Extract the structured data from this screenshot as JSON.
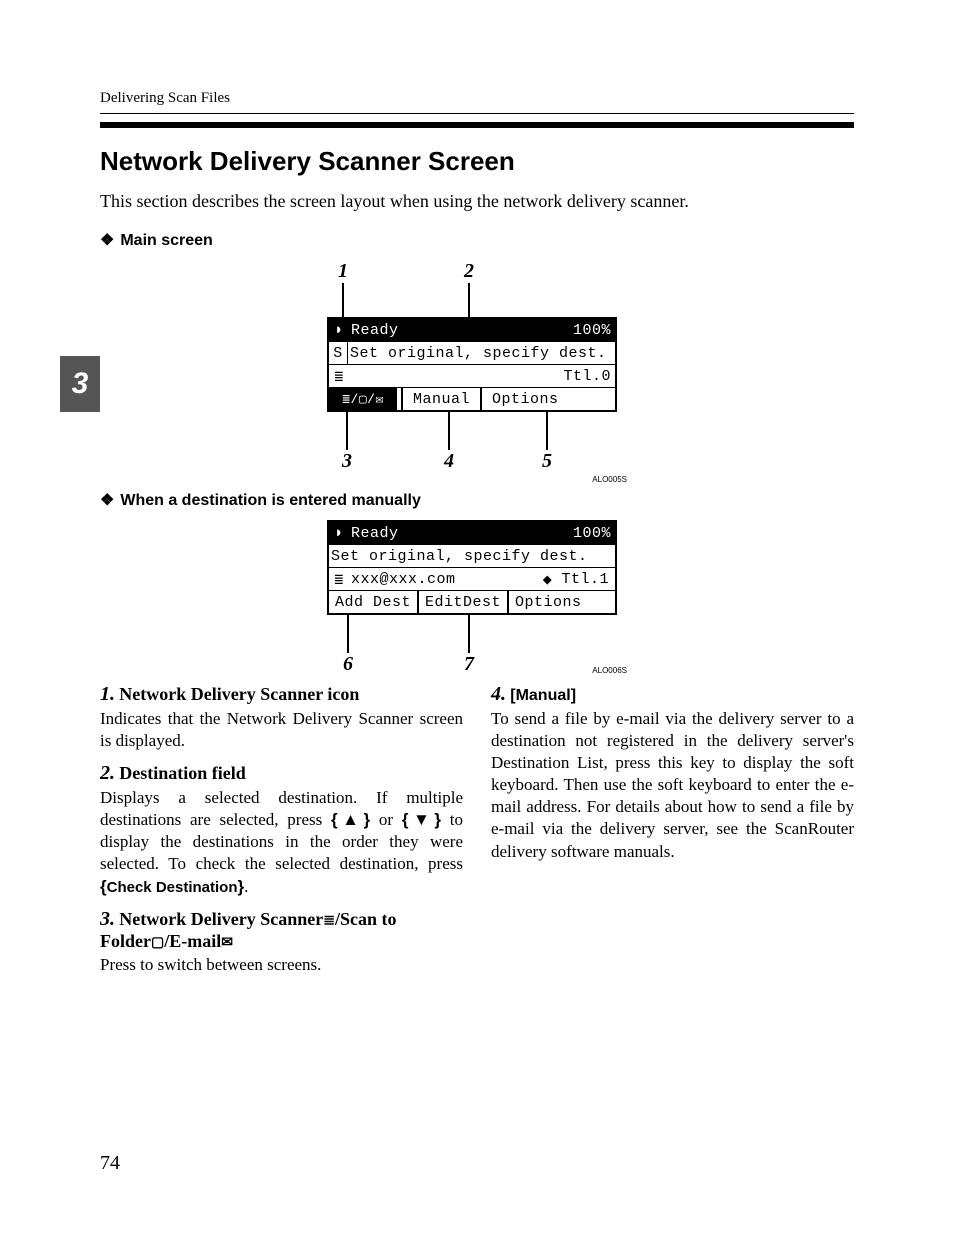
{
  "chapter_tab": "3",
  "running_head": "Delivering Scan Files",
  "section_title": "Network Delivery Scanner Screen",
  "intro": "This section describes the screen layout when using the network delivery scanner.",
  "sub1": {
    "label": "Main screen"
  },
  "fig1": {
    "callouts_top": [
      "1",
      "2"
    ],
    "callouts_bottom": [
      "3",
      "4",
      "5"
    ],
    "row1": {
      "ready": "Ready",
      "pct": "100%"
    },
    "row2": {
      "text": "Set original, specify dest."
    },
    "row3": {
      "ttl": "Ttl.0"
    },
    "row4": {
      "manual": "Manual",
      "options": "Options"
    },
    "note": "ALO005S"
  },
  "sub2": {
    "label": "When a destination is entered manually"
  },
  "fig2": {
    "callouts_bottom": [
      "6",
      "7"
    ],
    "row1": {
      "ready": "Ready",
      "pct": "100%"
    },
    "row2": {
      "text": "Set original, specify dest."
    },
    "row3": {
      "dest": "xxx@xxx.com",
      "ttl": "Ttl.1"
    },
    "row4": {
      "add": "Add Dest",
      "edit": "EditDest",
      "options": "Options"
    },
    "note": "ALO006S"
  },
  "items_left": [
    {
      "num": "1.",
      "title": "Network Delivery Scanner icon",
      "body": "Indicates that the Network Delivery Scanner screen is displayed."
    },
    {
      "num": "2.",
      "title": "Destination field",
      "body_parts": {
        "a": "Displays a selected destination. If multiple destinations are selected, press ",
        "key_up": "U",
        "mid": " or ",
        "key_down": "T",
        "b": " to display the destinations in the order they were selected. To check the selected destination, press ",
        "key_chk": "Check Destination",
        "c": "."
      }
    },
    {
      "num": "3.",
      "title_parts": {
        "a": "Network Delivery Scanner",
        "b": "/Scan to Folder",
        "c": "/E-mail"
      },
      "body": "Press to switch between screens."
    }
  ],
  "items_right": [
    {
      "num": "4.",
      "title_sans": "[Manual]",
      "body": "To send a file by e-mail via the delivery server to a destination not registered in the delivery server's Destination List, press this key to display the soft keyboard. Then use the soft keyboard to enter the e-mail address. For details about how to send a file by e-mail via the delivery server, see the ScanRouter delivery software manuals."
    }
  ],
  "page_number": "74"
}
